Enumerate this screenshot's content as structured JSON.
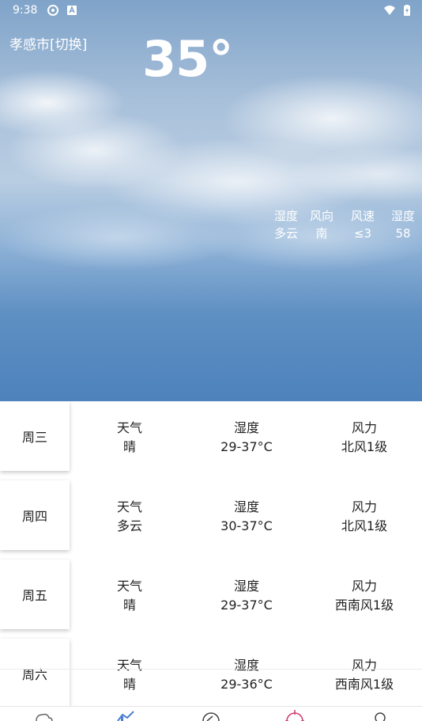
{
  "status_bar": {
    "time": "9:38"
  },
  "hero": {
    "city": "孝感市[切换]",
    "temperature": "35°",
    "stats": [
      {
        "label": "湿度",
        "value": "多云"
      },
      {
        "label": "风向",
        "value": "南"
      },
      {
        "label": "风速",
        "value": "≤3"
      },
      {
        "label": "湿度",
        "value": "58"
      }
    ]
  },
  "forecast": [
    {
      "day": "周三",
      "weather_label": "天气",
      "weather": "晴",
      "humidity_label": "湿度",
      "humidity": "29-37°C",
      "wind_label": "风力",
      "wind": "北风1级"
    },
    {
      "day": "周四",
      "weather_label": "天气",
      "weather": "多云",
      "humidity_label": "湿度",
      "humidity": "30-37°C",
      "wind_label": "风力",
      "wind": "北风1级"
    },
    {
      "day": "周五",
      "weather_label": "天气",
      "weather": "晴",
      "humidity_label": "湿度",
      "humidity": "29-37°C",
      "wind_label": "风力",
      "wind": "西南风1级"
    },
    {
      "day": "周六",
      "weather_label": "天气",
      "weather": "晴",
      "humidity_label": "湿度",
      "humidity": "29-36°C",
      "wind_label": "风力",
      "wind": "西南风1级"
    }
  ],
  "nav": {
    "tabs": [
      {
        "icon": "cloud-icon",
        "color": "#666666"
      },
      {
        "icon": "chart-icon",
        "color": "#4a7fd0"
      },
      {
        "icon": "compass-icon",
        "color": "#444444"
      },
      {
        "icon": "target-icon",
        "color": "#d23a6a"
      },
      {
        "icon": "person-icon",
        "color": "#444444"
      }
    ]
  }
}
